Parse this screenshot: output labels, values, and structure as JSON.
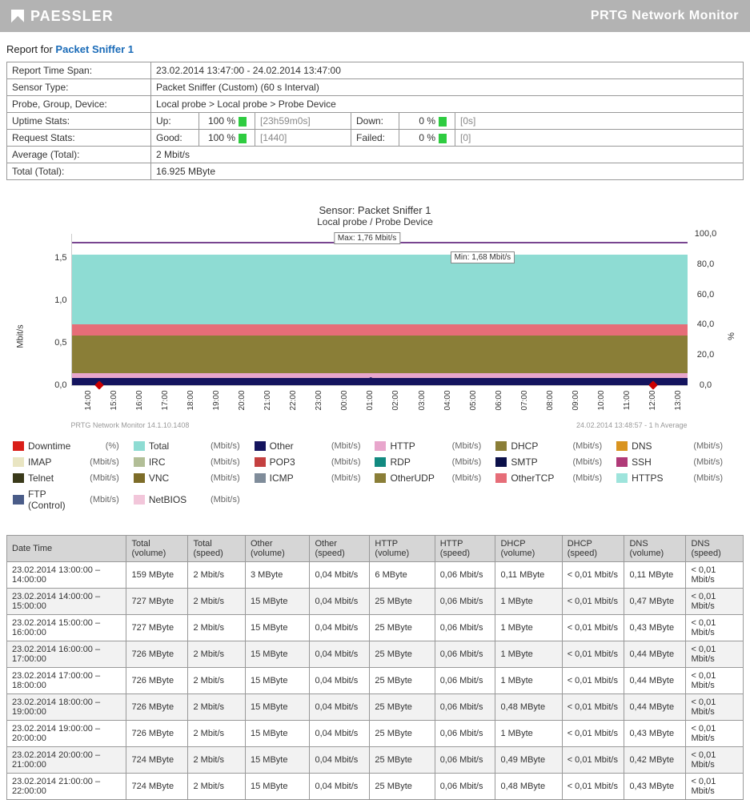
{
  "header": {
    "brand": "PAESSLER",
    "product": "PRTG Network Monitor"
  },
  "report": {
    "title_prefix": "Report for ",
    "title_link": "Packet Sniffer 1",
    "rows": {
      "timespan_label": "Report Time Span:",
      "timespan_value": "23.02.2014 13:47:00 - 24.02.2014 13:47:00",
      "sensortype_label": "Sensor Type:",
      "sensortype_value": "Packet Sniffer (Custom) (60 s Interval)",
      "pgd_label": "Probe, Group, Device:",
      "pgd_value": "Local probe > Local probe > Probe Device",
      "uptime_label": "Uptime Stats:",
      "up_label": "Up:",
      "up_pct": "100 %",
      "up_dur": "[23h59m0s]",
      "down_label": "Down:",
      "down_pct": "0 %",
      "down_dur": "[0s]",
      "request_label": "Request Stats:",
      "good_label": "Good:",
      "good_pct": "100 %",
      "good_count": "[1440]",
      "failed_label": "Failed:",
      "failed_pct": "0 %",
      "failed_count": "[0]",
      "avg_label": "Average (Total):",
      "avg_value": "2 Mbit/s",
      "total_label": "Total (Total):",
      "total_value": "16.925 MByte"
    }
  },
  "chart_data": {
    "type": "area",
    "title": "Sensor: Packet Sniffer 1",
    "subtitle": "Local probe / Probe Device",
    "ylabel_left": "Mbit/s",
    "ylabel_right": "%",
    "ylim_left": [
      0.0,
      1.76
    ],
    "ylim_right": [
      0.0,
      100.0
    ],
    "yticks_left": [
      "0,0",
      "0,5",
      "1,0",
      "1,5"
    ],
    "yticks_right": [
      "0,0",
      "20,0",
      "40,0",
      "60,0",
      "80,0",
      "100,0"
    ],
    "x": [
      "14:00",
      "15:00",
      "16:00",
      "17:00",
      "18:00",
      "19:00",
      "20:00",
      "21:00",
      "22:00",
      "23:00",
      "00:00",
      "01:00",
      "02:00",
      "03:00",
      "04:00",
      "05:00",
      "06:00",
      "07:00",
      "08:00",
      "09:00",
      "10:00",
      "11:00",
      "12:00",
      "13:00"
    ],
    "max_label": "Max: 1,76 Mbit/s",
    "min_label": "Min: 1,68 Mbit/s",
    "series": [
      {
        "name": "Total",
        "color": "#8edcd3",
        "approx_value": 1.7
      },
      {
        "name": "OtherTCP",
        "color": "#e66d78",
        "approx_value": 0.7
      },
      {
        "name": "OtherUDP",
        "color": "#8a7e37",
        "approx_value": 0.55
      },
      {
        "name": "HTTP",
        "color": "#e8a6cc",
        "approx_value": 0.12
      },
      {
        "name": "Other",
        "color": "#14145e",
        "approx_value": 0.06
      }
    ],
    "footer_left": "PRTG Network Monitor 14.1.10.1408",
    "footer_right": "24.02.2014 13:48:57 - 1 h Average"
  },
  "legend": [
    {
      "name": "Downtime",
      "unit": "(%)",
      "color": "#d91e18"
    },
    {
      "name": "Total",
      "unit": "(Mbit/s)",
      "color": "#8edcd3"
    },
    {
      "name": "Other",
      "unit": "(Mbit/s)",
      "color": "#14145e"
    },
    {
      "name": "HTTP",
      "unit": "(Mbit/s)",
      "color": "#e8a6cc"
    },
    {
      "name": "DHCP",
      "unit": "(Mbit/s)",
      "color": "#8a7e37"
    },
    {
      "name": "DNS",
      "unit": "(Mbit/s)",
      "color": "#d99420"
    },
    {
      "name": "IMAP",
      "unit": "(Mbit/s)",
      "color": "#e9e5c2"
    },
    {
      "name": "IRC",
      "unit": "(Mbit/s)",
      "color": "#b2be97"
    },
    {
      "name": "POP3",
      "unit": "(Mbit/s)",
      "color": "#c44040"
    },
    {
      "name": "RDP",
      "unit": "(Mbit/s)",
      "color": "#128a80"
    },
    {
      "name": "SMTP",
      "unit": "(Mbit/s)",
      "color": "#0b1049"
    },
    {
      "name": "SSH",
      "unit": "(Mbit/s)",
      "color": "#b03a78"
    },
    {
      "name": "Telnet",
      "unit": "(Mbit/s)",
      "color": "#3a3a1a"
    },
    {
      "name": "VNC",
      "unit": "(Mbit/s)",
      "color": "#7d6c28"
    },
    {
      "name": "ICMP",
      "unit": "(Mbit/s)",
      "color": "#7f8c9a"
    },
    {
      "name": "OtherUDP",
      "unit": "(Mbit/s)",
      "color": "#8a7e37"
    },
    {
      "name": "OtherTCP",
      "unit": "(Mbit/s)",
      "color": "#e66d78"
    },
    {
      "name": "HTTPS",
      "unit": "(Mbit/s)",
      "color": "#9ee4dc"
    },
    {
      "name": "FTP (Control)",
      "unit": "(Mbit/s)",
      "color": "#4a5c88"
    },
    {
      "name": "NetBIOS",
      "unit": "(Mbit/s)",
      "color": "#f2c6da"
    }
  ],
  "table": {
    "headers": [
      "Date Time",
      "Total (volume)",
      "Total (speed)",
      "Other (volume)",
      "Other (speed)",
      "HTTP (volume)",
      "HTTP (speed)",
      "DHCP (volume)",
      "DHCP (speed)",
      "DNS (volume)",
      "DNS (speed)"
    ],
    "rows": [
      [
        "23.02.2014 13:00:00 – 14:00:00",
        "159 MByte",
        "2 Mbit/s",
        "3 MByte",
        "0,04 Mbit/s",
        "6 MByte",
        "0,06 Mbit/s",
        "0,11 MByte",
        "< 0,01 Mbit/s",
        "0,11 MByte",
        "< 0,01 Mbit/s"
      ],
      [
        "23.02.2014 14:00:00 – 15:00:00",
        "727 MByte",
        "2 Mbit/s",
        "15 MByte",
        "0,04 Mbit/s",
        "25 MByte",
        "0,06 Mbit/s",
        "1 MByte",
        "< 0,01 Mbit/s",
        "0,47 MByte",
        "< 0,01 Mbit/s"
      ],
      [
        "23.02.2014 15:00:00 – 16:00:00",
        "727 MByte",
        "2 Mbit/s",
        "15 MByte",
        "0,04 Mbit/s",
        "25 MByte",
        "0,06 Mbit/s",
        "1 MByte",
        "< 0,01 Mbit/s",
        "0,43 MByte",
        "< 0,01 Mbit/s"
      ],
      [
        "23.02.2014 16:00:00 – 17:00:00",
        "726 MByte",
        "2 Mbit/s",
        "15 MByte",
        "0,04 Mbit/s",
        "25 MByte",
        "0,06 Mbit/s",
        "1 MByte",
        "< 0,01 Mbit/s",
        "0,44 MByte",
        "< 0,01 Mbit/s"
      ],
      [
        "23.02.2014 17:00:00 – 18:00:00",
        "726 MByte",
        "2 Mbit/s",
        "15 MByte",
        "0,04 Mbit/s",
        "25 MByte",
        "0,06 Mbit/s",
        "1 MByte",
        "< 0,01 Mbit/s",
        "0,44 MByte",
        "< 0,01 Mbit/s"
      ],
      [
        "23.02.2014 18:00:00 – 19:00:00",
        "726 MByte",
        "2 Mbit/s",
        "15 MByte",
        "0,04 Mbit/s",
        "25 MByte",
        "0,06 Mbit/s",
        "0,48 MByte",
        "< 0,01 Mbit/s",
        "0,44 MByte",
        "< 0,01 Mbit/s"
      ],
      [
        "23.02.2014 19:00:00 – 20:00:00",
        "726 MByte",
        "2 Mbit/s",
        "15 MByte",
        "0,04 Mbit/s",
        "25 MByte",
        "0,06 Mbit/s",
        "1 MByte",
        "< 0,01 Mbit/s",
        "0,43 MByte",
        "< 0,01 Mbit/s"
      ],
      [
        "23.02.2014 20:00:00 – 21:00:00",
        "724 MByte",
        "2 Mbit/s",
        "15 MByte",
        "0,04 Mbit/s",
        "25 MByte",
        "0,06 Mbit/s",
        "0,49 MByte",
        "< 0,01 Mbit/s",
        "0,42 MByte",
        "< 0,01 Mbit/s"
      ],
      [
        "23.02.2014 21:00:00 – 22:00:00",
        "724 MByte",
        "2 Mbit/s",
        "15 MByte",
        "0,04 Mbit/s",
        "25 MByte",
        "0,06 Mbit/s",
        "0,48 MByte",
        "< 0,01 Mbit/s",
        "0,43 MByte",
        "< 0,01 Mbit/s"
      ]
    ]
  }
}
